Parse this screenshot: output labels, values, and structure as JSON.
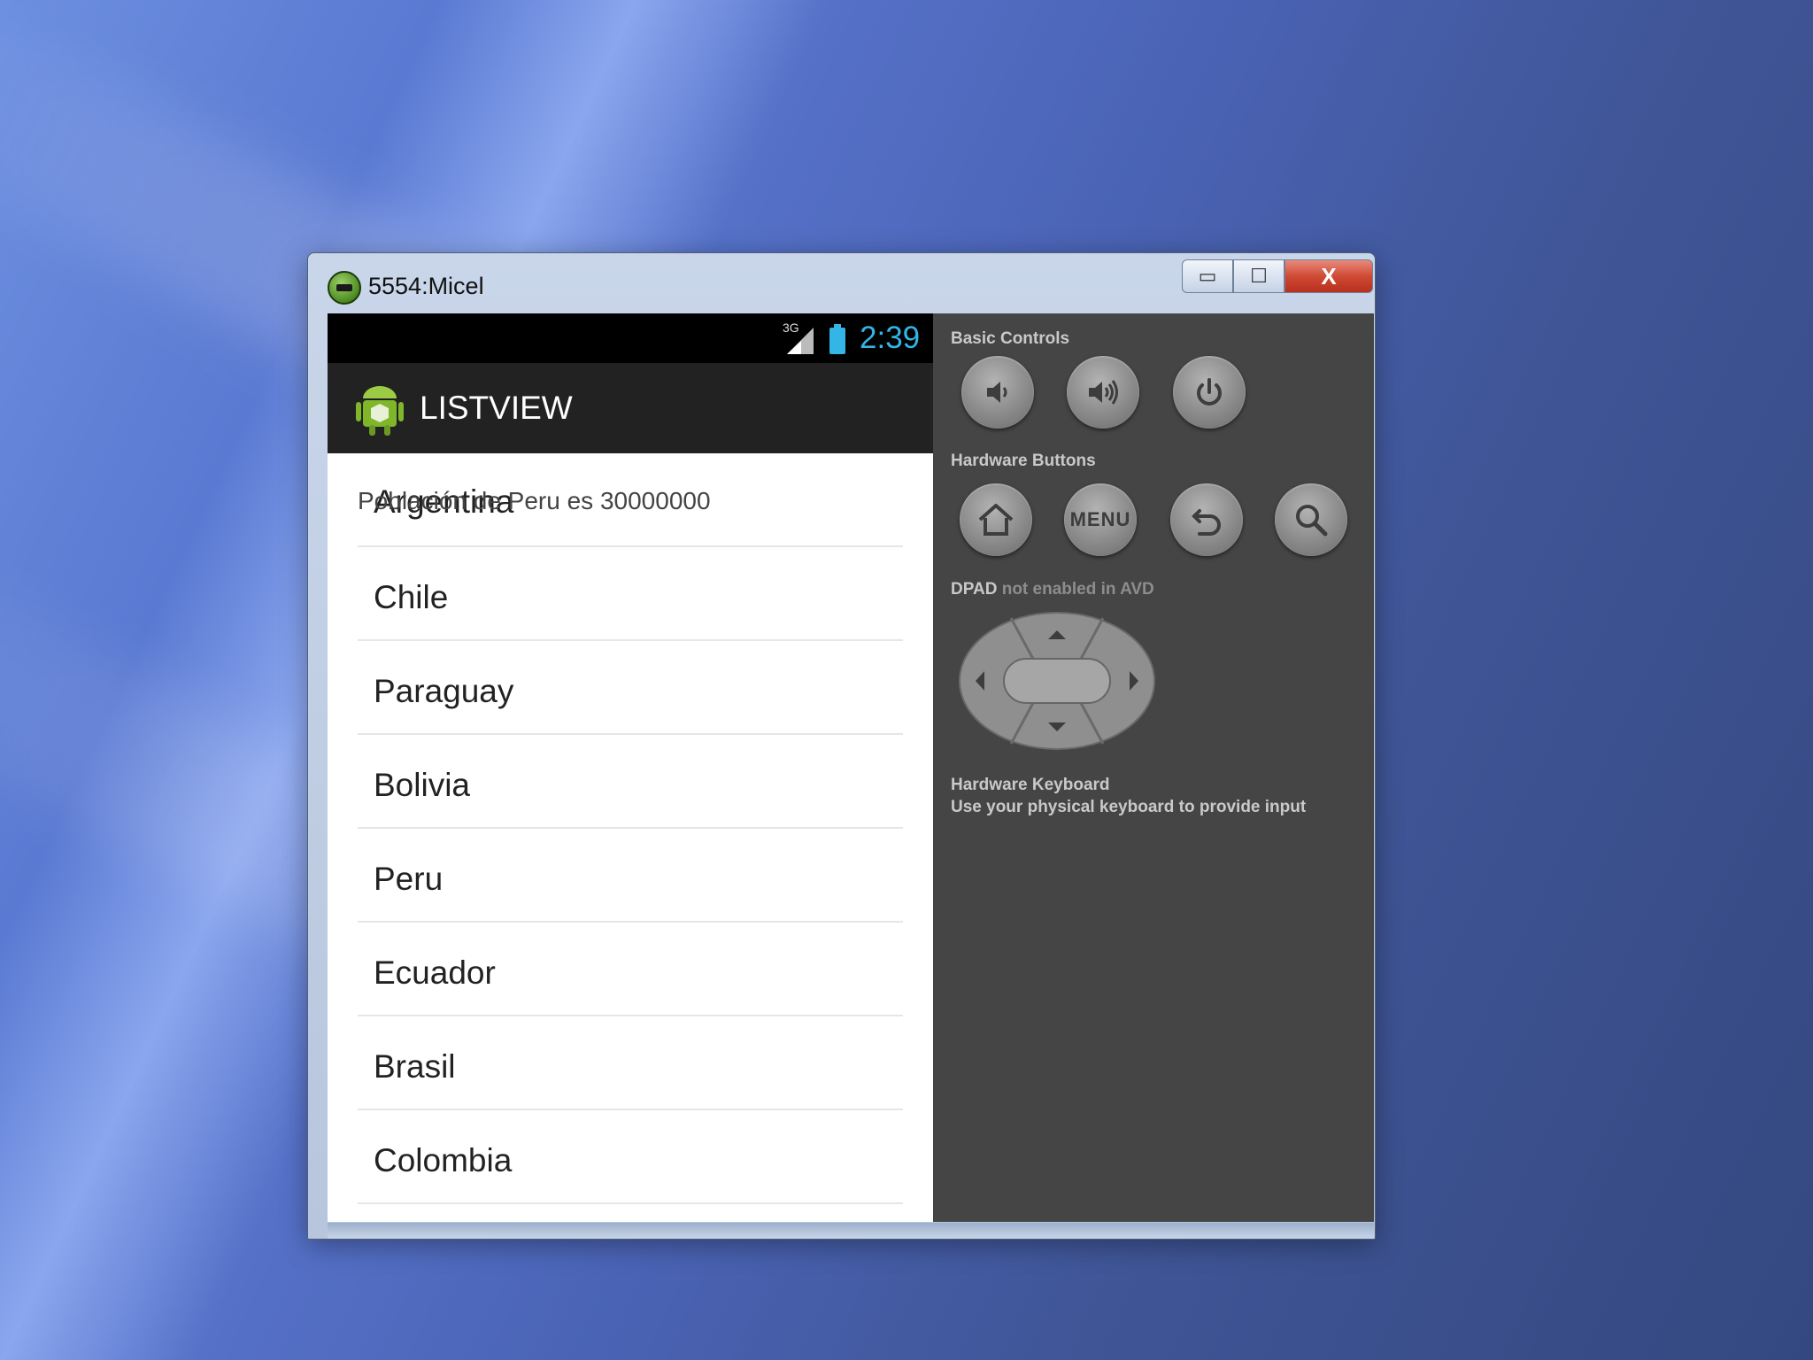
{
  "window": {
    "title": "5554:Micel",
    "minimize_label": "▭",
    "maximize_label": "☐",
    "close_label": "X"
  },
  "statusbar": {
    "network": "3G",
    "time": "2:39"
  },
  "actionbar": {
    "title": "LISTVIEW"
  },
  "toast": {
    "text": "Población de Peru es 30000000"
  },
  "list": {
    "items": [
      "Argentina",
      "Chile",
      "Paraguay",
      "Bolivia",
      "Peru",
      "Ecuador",
      "Brasil",
      "Colombia"
    ]
  },
  "controls": {
    "basic_label": "Basic Controls",
    "hardware_label": "Hardware Buttons",
    "menu_label": "MENU",
    "dpad_label": "DPAD",
    "dpad_note": "not enabled in AVD",
    "keyboard_label": "Hardware Keyboard",
    "keyboard_note": "Use your physical keyboard to provide input"
  },
  "colors": {
    "accent_blue": "#33b5e5",
    "actionbar_bg": "#222222",
    "controls_bg": "#454545"
  }
}
